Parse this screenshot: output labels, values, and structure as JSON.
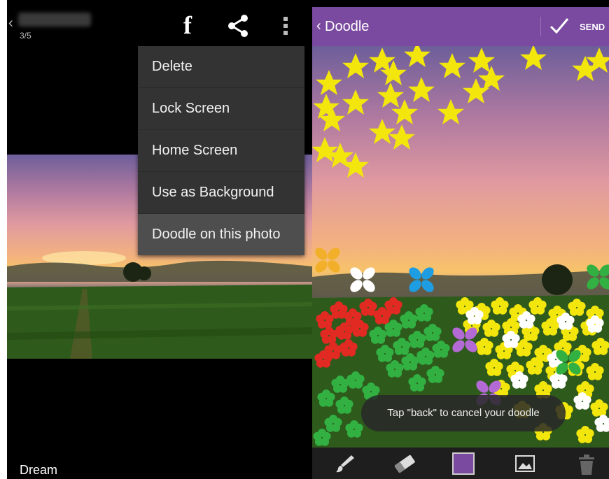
{
  "left": {
    "counter": "3/5",
    "icons": {
      "facebook": "f",
      "share": "share-icon",
      "more": "overflow-icon"
    },
    "menu": [
      "Delete",
      "Lock Screen",
      "Home Screen",
      "Use as Background",
      "Doodle on this photo"
    ],
    "caption": "Dream"
  },
  "right": {
    "back_title": "Doodle",
    "send_label": "SEND",
    "toast": "Tap \"back\" to cancel your doodle",
    "tools": [
      "brush-icon",
      "eraser-icon",
      "color-swatch",
      "image-icon",
      "trash-icon"
    ],
    "accent": "#7a4aa0",
    "swatch_color": "#7a4aa0"
  }
}
